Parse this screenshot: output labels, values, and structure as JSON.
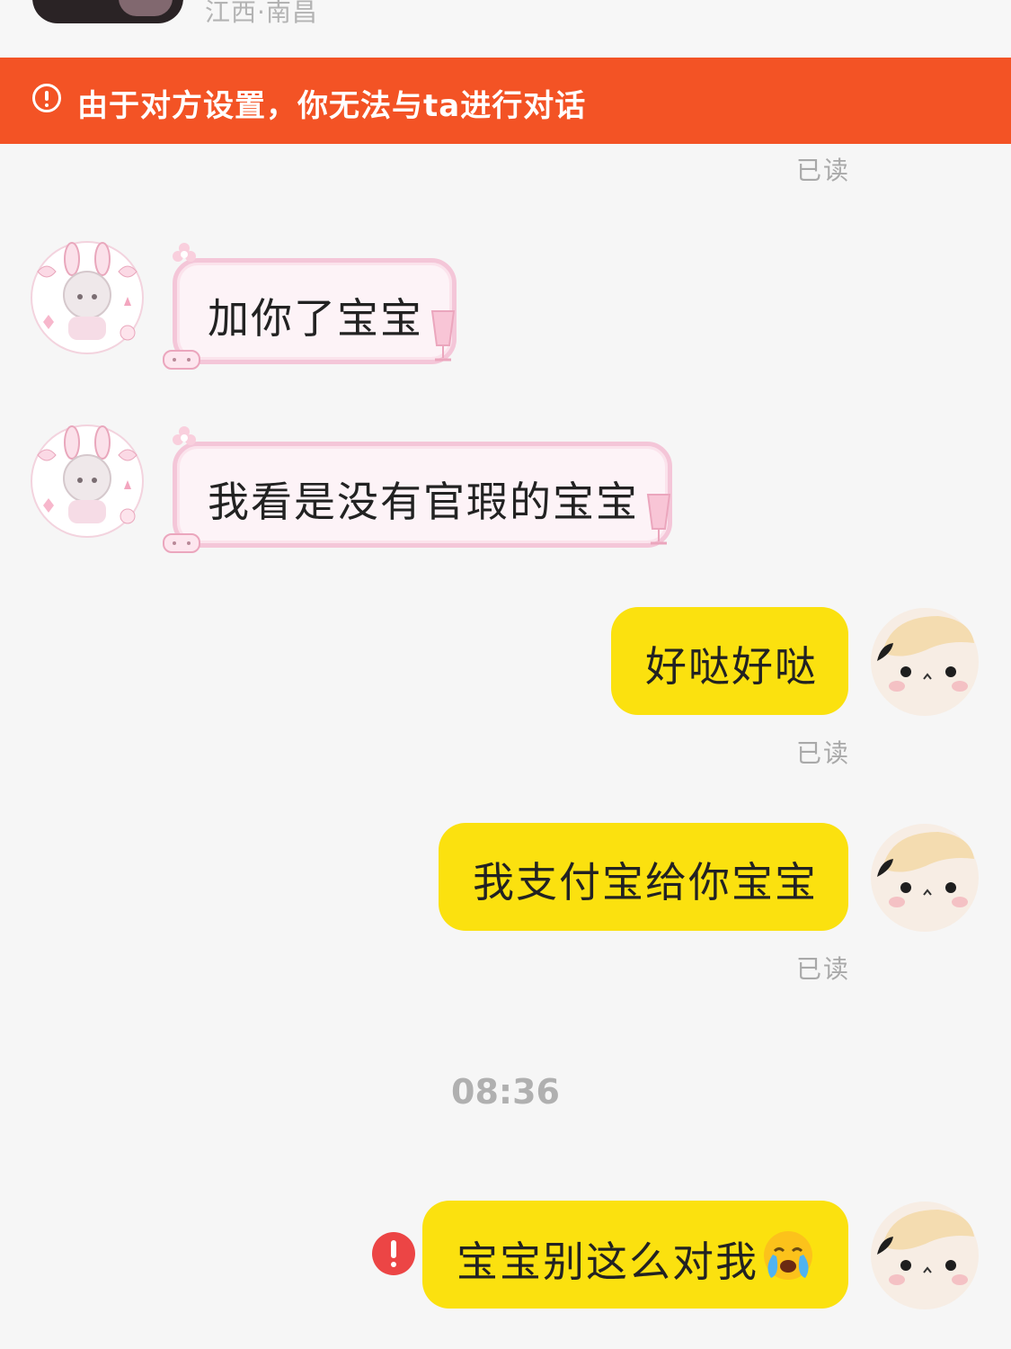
{
  "header": {
    "location": "江西·南昌"
  },
  "banner": {
    "icon": "exclamation-circle-icon",
    "text": "由于对方设置，你无法与ta进行对话"
  },
  "messages": [
    {
      "direction": "incoming",
      "text": "加你了宝宝"
    },
    {
      "direction": "incoming",
      "text": "我看是没有官瑕的宝宝"
    },
    {
      "direction": "outgoing",
      "text": "好哒好哒",
      "receipt": "已读"
    },
    {
      "direction": "outgoing",
      "text": "我支付宝给你宝宝",
      "receipt": "已读"
    },
    {
      "direction": "outgoing",
      "text": "宝宝别这么对我",
      "emoji": "crying-face-icon",
      "status": "send-failed"
    }
  ],
  "top_receipt": "已读",
  "timestamp": "08:36",
  "colors": {
    "banner": "#f35325",
    "outgoing_bubble": "#fbe10f",
    "incoming_bubble": "#fdf3f7",
    "incoming_border": "#f4c6d8",
    "error": "#ec4545"
  }
}
